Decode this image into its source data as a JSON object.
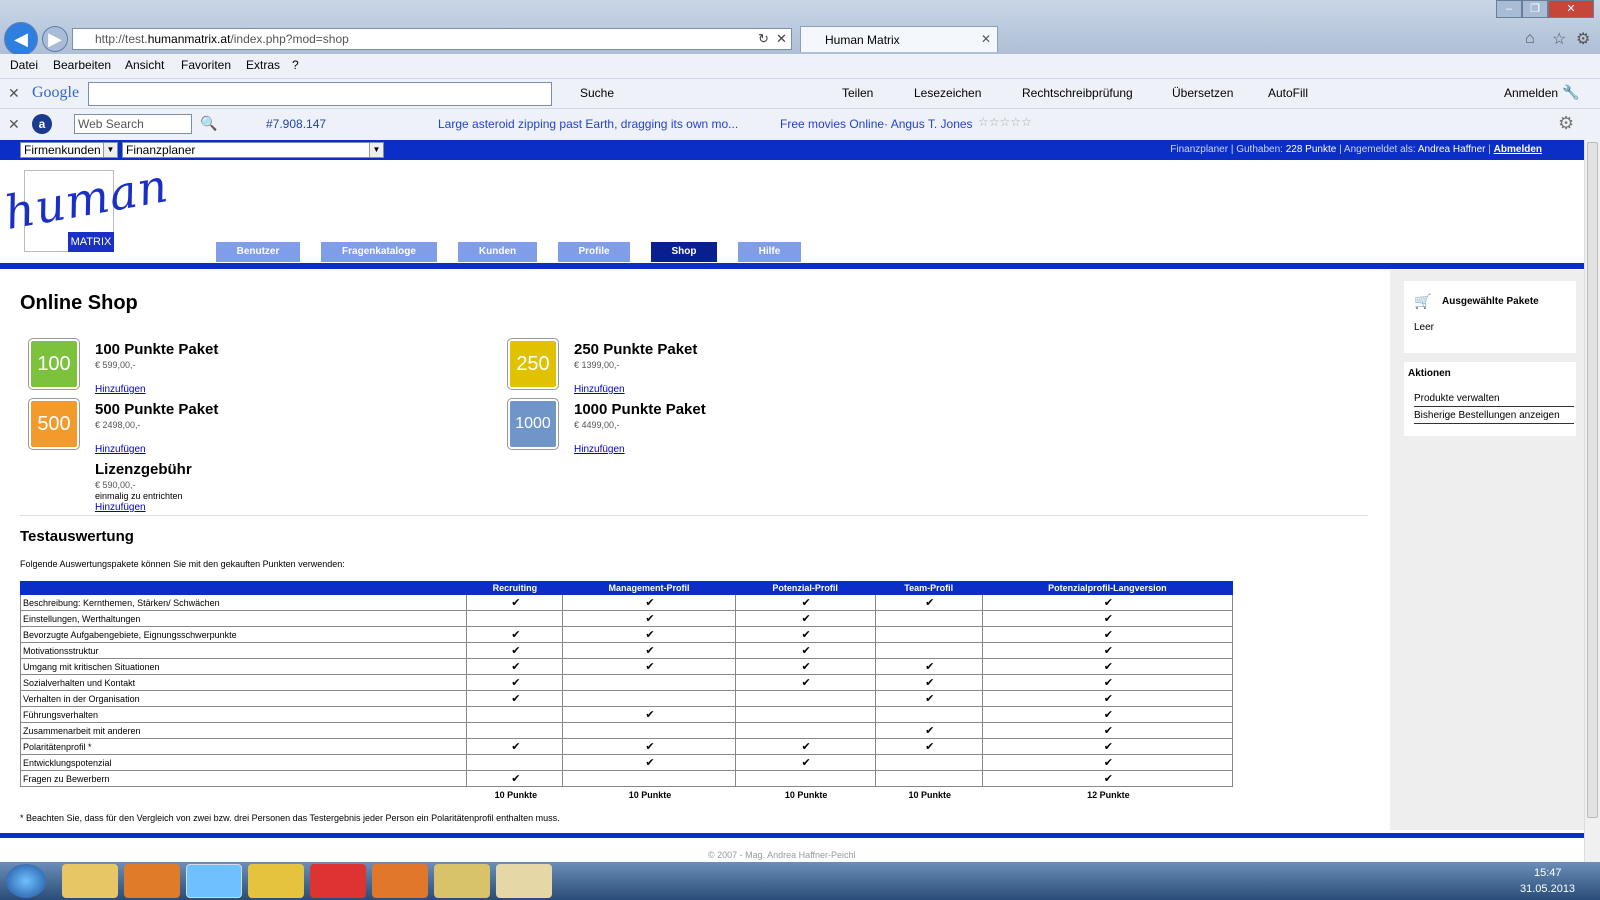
{
  "browser": {
    "url_prefix": "http://test.",
    "url_domain": "humanmatrix.at",
    "url_suffix": "/index.php?mod=shop",
    "tab_title": "Human Matrix",
    "menu": [
      "Datei",
      "Bearbeiten",
      "Ansicht",
      "Favoriten",
      "Extras",
      "?"
    ],
    "google_toolbar": {
      "logo": "Google",
      "search": "Suche",
      "share": "Teilen",
      "bookmarks": "Lesezeichen",
      "spell": "Rechtschreibprüfung",
      "translate": "Übersetzen",
      "autofill": "AutoFill",
      "signin": "Anmelden"
    },
    "ask_toolbar": {
      "search_placeholder": "Web Search",
      "count": "#7.908.147",
      "news": "Large asteroid zipping past Earth, dragging its own mo...",
      "movies": "Free movies Online· Angus T. Jones"
    }
  },
  "topbar": {
    "select1": "Firmenkunden",
    "select2": "Finanzplaner",
    "info_label": "Finanzplaner | Guthaben: ",
    "credits": "228 Punkte",
    "info_mid": " | Angemeldet als: ",
    "user": "Andrea Haffner",
    "sep": " | ",
    "logout": "Abmelden"
  },
  "logo": {
    "text": "human",
    "badge": "MATRIX"
  },
  "nav": [
    "Benutzer",
    "Fragenkataloge",
    "Kunden",
    "Profile",
    "Shop",
    "Hilfe"
  ],
  "page_title": "Online Shop",
  "packages": [
    {
      "icon": "100",
      "name": "100 Punkte Paket",
      "price": "€ 599,00,-",
      "add": "Hinzufügen",
      "color": "#7cc23c"
    },
    {
      "icon": "250",
      "name": "250 Punkte Paket",
      "price": "€ 1399,00,-",
      "add": "Hinzufügen",
      "color": "#e0c200"
    },
    {
      "icon": "500",
      "name": "500 Punkte Paket",
      "price": "€ 2498,00,-",
      "add": "Hinzufügen",
      "color": "#f29b2c"
    },
    {
      "icon": "1000",
      "name": "1000 Punkte Paket",
      "price": "€ 4499,00,-",
      "add": "Hinzufügen",
      "color": "#6f95c9"
    }
  ],
  "license": {
    "name": "Lizenzgebühr",
    "price": "€ 590,00,-",
    "note": "einmalig zu entrichten",
    "add": "Hinzufügen"
  },
  "eval": {
    "title": "Testauswertung",
    "intro": "Folgende Auswertungspakete können Sie mit den gekauften Punkten verwenden:",
    "headers": [
      "",
      "Recruiting",
      "Management-Profil",
      "Potenzial-Profil",
      "Team-Profil",
      "Potenzialprofil-Langversion"
    ],
    "rows": [
      {
        "label": "Beschreibung: Kernthemen, Stärken/ Schwächen",
        "cells": [
          "✔",
          "✔",
          "✔",
          "✔",
          "✔"
        ]
      },
      {
        "label": "Einstellungen, Werthaltungen",
        "cells": [
          "",
          "✔",
          "✔",
          "",
          "✔"
        ]
      },
      {
        "label": "Bevorzugte Aufgabengebiete, Eignungsschwerpunkte",
        "cells": [
          "✔",
          "✔",
          "✔",
          "",
          "✔"
        ]
      },
      {
        "label": "Motivationsstruktur",
        "cells": [
          "✔",
          "✔",
          "✔",
          "",
          "✔"
        ]
      },
      {
        "label": "Umgang mit kritischen Situationen",
        "cells": [
          "✔",
          "✔",
          "✔",
          "✔",
          "✔"
        ]
      },
      {
        "label": "Sozialverhalten und Kontakt",
        "cells": [
          "✔",
          "",
          "✔",
          "✔",
          "✔"
        ]
      },
      {
        "label": "Verhalten in der Organisation",
        "cells": [
          "✔",
          "",
          "",
          "✔",
          "✔"
        ]
      },
      {
        "label": "Führungsverhalten",
        "cells": [
          "",
          "✔",
          "",
          "",
          "✔"
        ]
      },
      {
        "label": "Zusammenarbeit mit anderen",
        "cells": [
          "",
          "",
          "",
          "✔",
          "✔"
        ]
      },
      {
        "label": "Polaritätenprofil *",
        "cells": [
          "✔",
          "✔",
          "✔",
          "✔",
          "✔"
        ]
      },
      {
        "label": "Entwicklungspotenzial",
        "cells": [
          "",
          "✔",
          "✔",
          "",
          "✔"
        ]
      },
      {
        "label": "Fragen zu Bewerbern",
        "cells": [
          "✔",
          "",
          "",
          "",
          "✔"
        ]
      }
    ],
    "points": [
      "10 Punkte",
      "10 Punkte",
      "10 Punkte",
      "10 Punkte",
      "12 Punkte"
    ],
    "footnote": "* Beachten Sie, dass für den Vergleich von zwei bzw. drei Personen das Testergebnis jeder Person ein Polaritätenprofil enthalten muss."
  },
  "sidebar": {
    "cart_title": "Ausgewählte Pakete",
    "cart_empty": "Leer",
    "actions_title": "Aktionen",
    "actions": [
      "Produkte verwalten",
      "Bisherige Bestellungen anzeigen"
    ]
  },
  "footer": "© 2007 - Mag. Andrea Haffner-Peichl",
  "taskbar": {
    "time": "15:47",
    "date": "31.05.2013"
  }
}
